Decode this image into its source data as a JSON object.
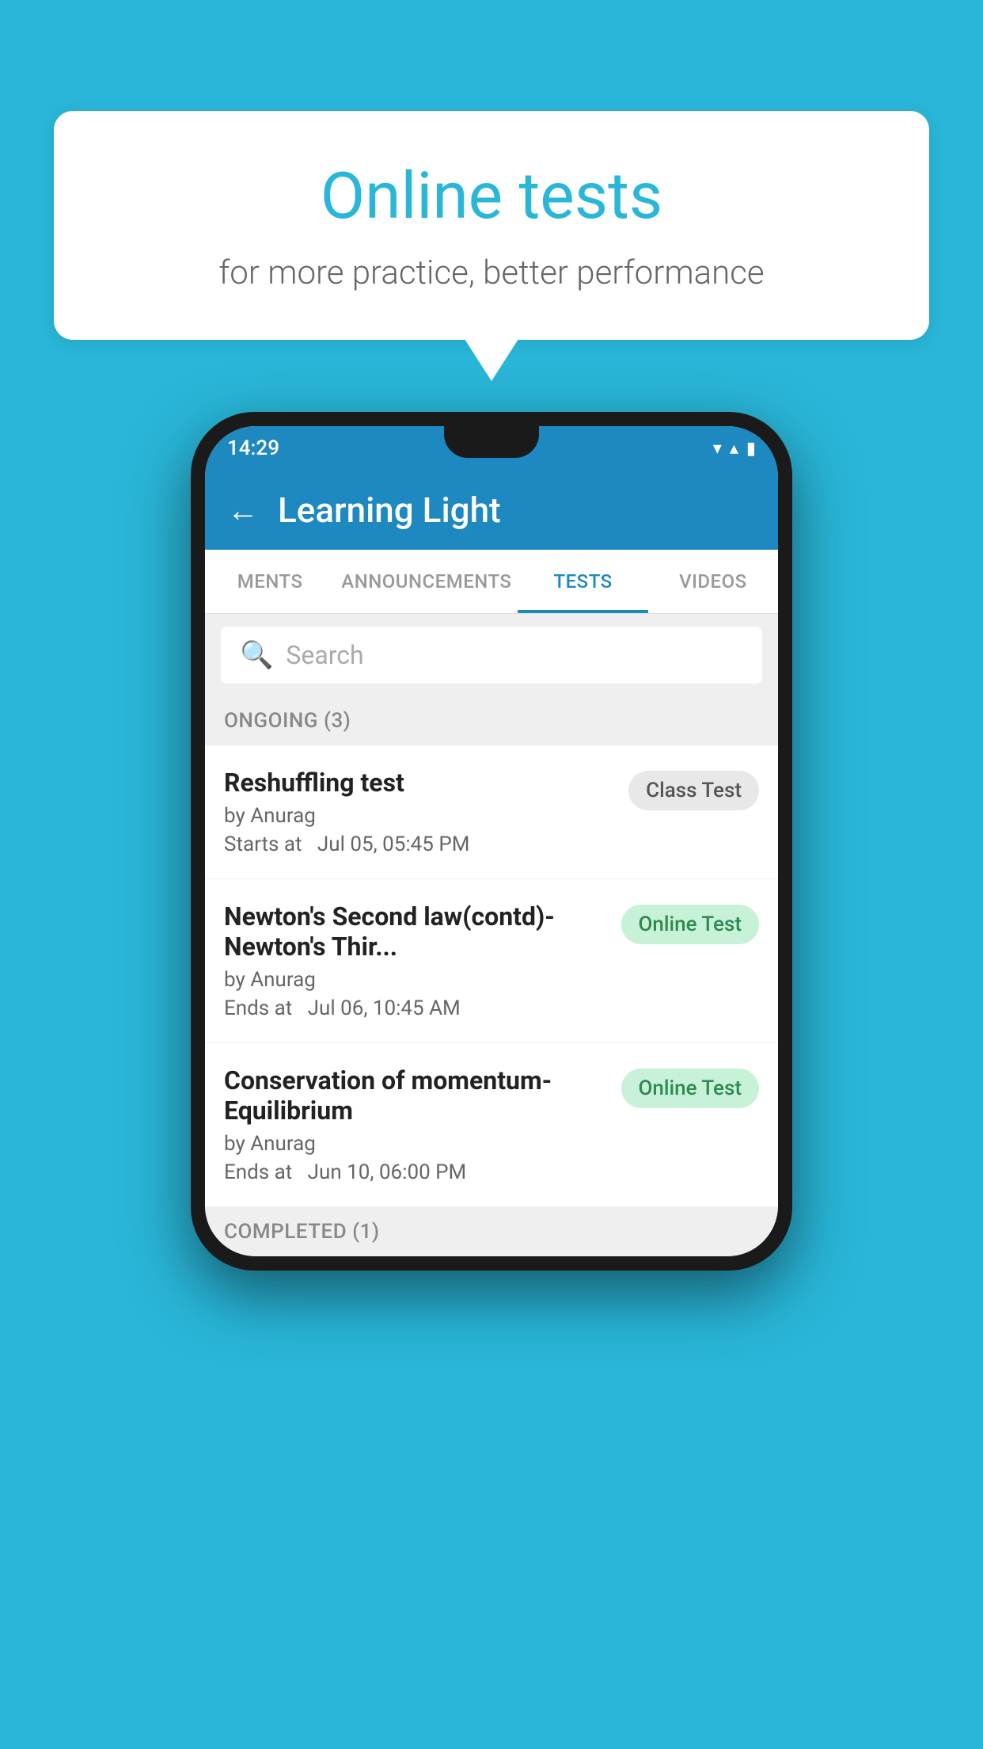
{
  "background": {
    "color": "#29b6d8"
  },
  "speech_bubble": {
    "title": "Online tests",
    "subtitle": "for more practice, better performance"
  },
  "app": {
    "title": "Learning Light",
    "back_label": "←"
  },
  "status_bar": {
    "time": "14:29",
    "wifi": "▼",
    "signal": "▲",
    "battery": "▮"
  },
  "tabs": [
    {
      "label": "MENTS",
      "active": false
    },
    {
      "label": "ANNOUNCEMENTS",
      "active": false
    },
    {
      "label": "TESTS",
      "active": true
    },
    {
      "label": "VIDEOS",
      "active": false
    }
  ],
  "search": {
    "placeholder": "Search"
  },
  "ongoing_section": {
    "label": "ONGOING (3)"
  },
  "test_items": [
    {
      "name": "Reshuffling test",
      "author": "by Anurag",
      "date_label": "Starts at",
      "date": "Jul 05, 05:45 PM",
      "badge": "Class Test",
      "badge_type": "class"
    },
    {
      "name": "Newton's Second law(contd)-Newton's Thir...",
      "author": "by Anurag",
      "date_label": "Ends at",
      "date": "Jul 06, 10:45 AM",
      "badge": "Online Test",
      "badge_type": "online"
    },
    {
      "name": "Conservation of momentum-Equilibrium",
      "author": "by Anurag",
      "date_label": "Ends at",
      "date": "Jun 10, 06:00 PM",
      "badge": "Online Test",
      "badge_type": "online"
    }
  ],
  "completed_section": {
    "label": "COMPLETED (1)"
  }
}
